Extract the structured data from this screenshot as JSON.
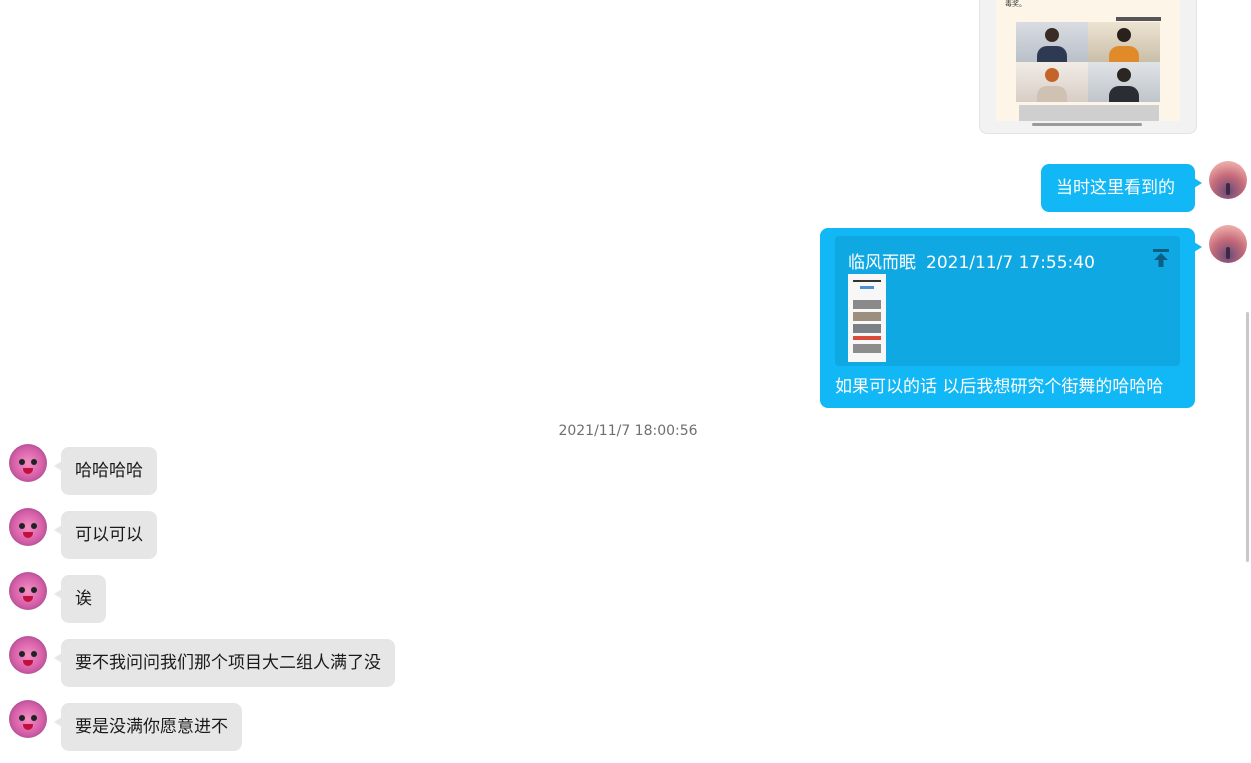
{
  "image_card": {
    "caption_fragment": "毒奖。"
  },
  "messages_me": [
    {
      "text": "当时这里看到的"
    },
    {
      "quote": {
        "sender": "临风而眠",
        "time": "2021/11/7 17:55:40"
      },
      "text": "如果可以的话 以后我想研究个街舞的哈哈哈"
    }
  ],
  "divider_time": "2021/11/7 18:00:56",
  "messages_them": [
    {
      "text": "哈哈哈哈"
    },
    {
      "text": "可以可以"
    },
    {
      "text": "诶"
    },
    {
      "text": "要不我问问我们那个项目大二组人满了没"
    },
    {
      "text": "要是没满你愿意进不"
    }
  ],
  "icons": {
    "pin": "pin-to-top-icon",
    "avatar_me": "sunset-avatar",
    "avatar_them": "pink-cartoon-avatar"
  },
  "colors": {
    "my_bubble": "#12b7f5",
    "their_bubble": "#e6e6e6",
    "background": "#ffffff"
  }
}
